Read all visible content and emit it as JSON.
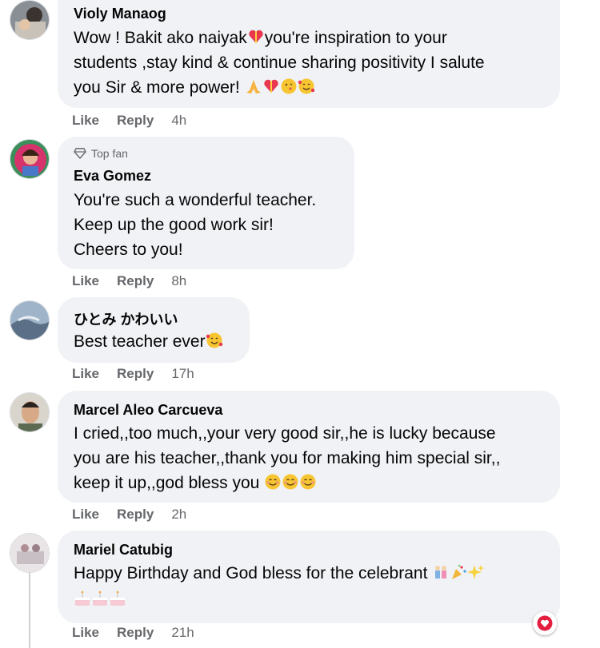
{
  "actions": {
    "like_label": "Like",
    "reply_label": "Reply"
  },
  "comments": [
    {
      "author": "Violy Manaog",
      "lines": [
        "Wow ! Bakit ako naiyak",
        "you're inspiration to your",
        "students ,stay kind & continue sharing positivity I salute",
        "you Sir & more power! "
      ],
      "time": "4h",
      "emoji": [
        "heart-gift",
        "folded-hands",
        "heart-gift",
        "kiss-face",
        "smiling-hearts-face"
      ]
    },
    {
      "badge": "Top fan",
      "author": "Eva Gomez",
      "lines": [
        "You're such a wonderful teacher.",
        "Keep up the good work sir!",
        "Cheers to you!"
      ],
      "time": "8h"
    },
    {
      "author": "ひとみ かわいい",
      "lines": [
        "Best teacher ever"
      ],
      "time": "17h",
      "emoji": [
        "smiling-hearts-face"
      ]
    },
    {
      "author": "Marcel Aleo Carcueva",
      "lines": [
        "I cried,,too much,,your very good sir,,he is lucky because",
        "you are his teacher,,thank you for making him special sir,,",
        "keep it up,,god bless you "
      ],
      "time": "2h",
      "emoji": [
        "smiling-face",
        "smiling-face",
        "smiling-face"
      ]
    },
    {
      "author": "Mariel Catubig",
      "lines": [
        "Happy Birthday and God bless for the celebrant "
      ],
      "time": "21h",
      "emoji": [
        "dancing-people",
        "party-popper",
        "sparkles",
        "birthday-cake",
        "birthday-cake",
        "birthday-cake"
      ]
    }
  ],
  "colors": {
    "bubble": "#f0f2f5",
    "meta": "#65676b",
    "text": "#050505",
    "reaction": "#e41e3f"
  }
}
